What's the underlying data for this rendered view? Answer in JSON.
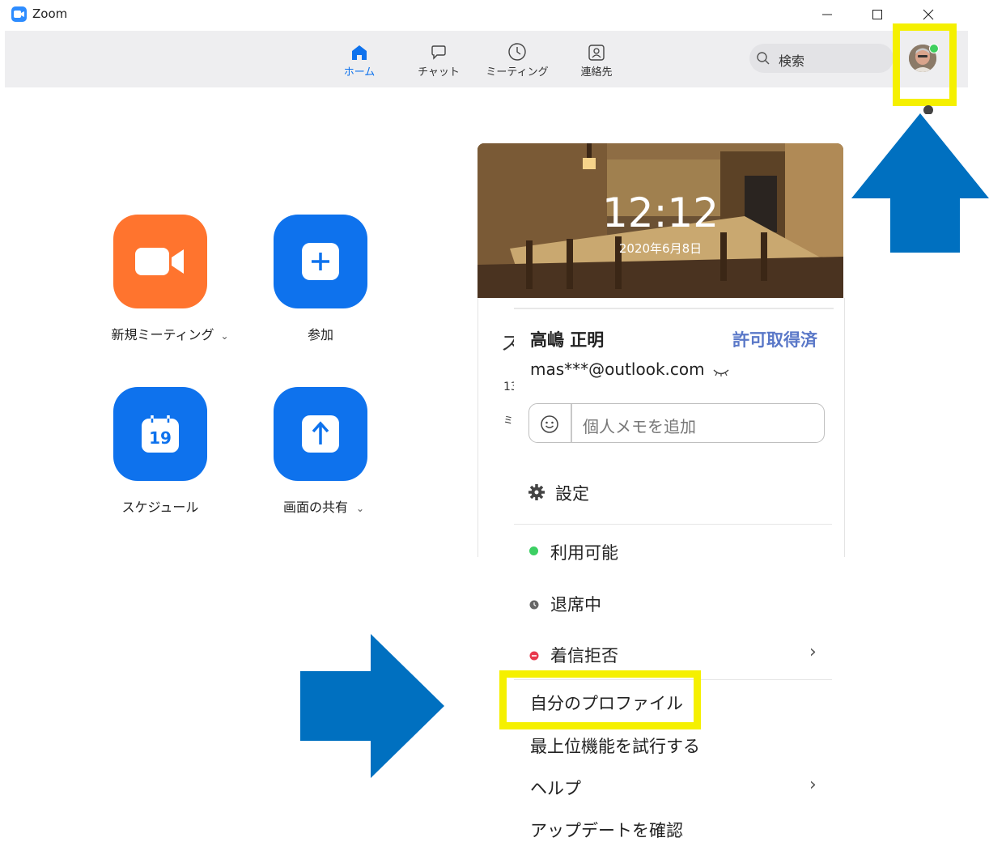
{
  "window": {
    "title": "Zoom"
  },
  "nav": {
    "tabs": [
      {
        "label": "ホーム",
        "icon": "home-icon",
        "active": true
      },
      {
        "label": "チャット",
        "icon": "chat-icon",
        "active": false
      },
      {
        "label": "ミーティング",
        "icon": "clock-icon",
        "active": false
      },
      {
        "label": "連絡先",
        "icon": "contacts-icon",
        "active": false
      }
    ],
    "search_label": "検索"
  },
  "home": {
    "actions": [
      {
        "label": "新規ミーティング",
        "icon": "video-camera-icon",
        "color": "#ff742e",
        "dropdown": true
      },
      {
        "label": "参加",
        "icon": "plus-icon",
        "color": "#0e72ed",
        "dropdown": false
      },
      {
        "label": "スケジュール",
        "icon": "calendar-icon",
        "color": "#0e72ed",
        "dropdown": false,
        "calendar_day": "19"
      },
      {
        "label": "画面の共有",
        "icon": "share-up-arrow-icon",
        "color": "#0e72ed",
        "dropdown": true
      }
    ]
  },
  "clock": {
    "time": "12:12",
    "date": "2020年6月8日"
  },
  "card_behind": {
    "title_char": "ス",
    "line1": "13",
    "line2": "ミ"
  },
  "profile_menu": {
    "name": "高嶋 正明",
    "license": "許可取得済",
    "email": "mas***@outlook.com",
    "memo_placeholder": "個人メモを追加",
    "settings": "設定",
    "status": [
      {
        "label": "利用可能",
        "color": "#3ccf63"
      },
      {
        "label": "退席中",
        "color": "#666666"
      },
      {
        "label": "着信拒否",
        "color": "#e8384d",
        "submenu": true
      }
    ],
    "my_profile": "自分のプロファイル",
    "try_top_features": "最上位機能を試行する",
    "help": "ヘルプ",
    "check_updates": "アップデートを確認"
  },
  "colors": {
    "accent": "#0e72ed",
    "highlight": "#f5f000",
    "arrow": "#0070c0",
    "license": "#5a78c8"
  }
}
